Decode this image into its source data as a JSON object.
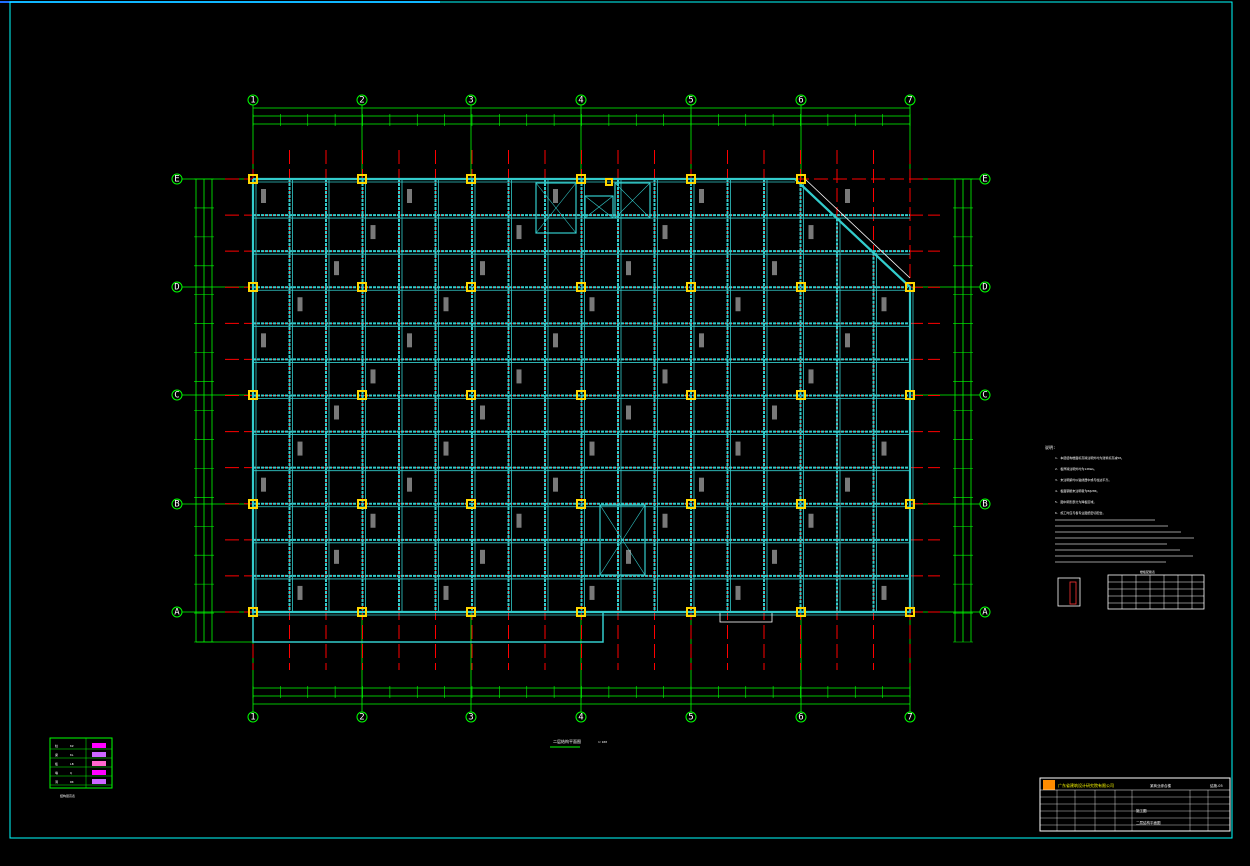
{
  "axes": {
    "columns": [
      "1",
      "2",
      "3",
      "4",
      "5",
      "6",
      "7"
    ],
    "rows": [
      "A",
      "B",
      "C",
      "D",
      "E"
    ]
  },
  "drawing": {
    "plan_title": "二层结构平面图",
    "plan_scale": "1:100"
  },
  "notes": {
    "heading": "说明:",
    "lines": [
      "1. 本层结构楼面标高除注明外均为建筑标高减50。",
      "2. 板厚除注明外均为120mm。",
      "3. 未注明梁均以轴线居中或与柱边平齐。",
      "4. 板面钢筋未注明者为8@200。",
      "5. 图中阴影部分为降板区域。",
      "6. 施工时应与各专业图纸密切配合。"
    ],
    "table_title": "楼板配筋表"
  },
  "legend": {
    "title": "图例",
    "rows": [
      {
        "label": "柱",
        "value": "KZ"
      },
      {
        "label": "梁",
        "value": "KL"
      },
      {
        "label": "板",
        "value": "LB"
      },
      {
        "label": "墙",
        "value": "Q"
      },
      {
        "label": "洞",
        "value": "DK"
      }
    ],
    "footer": "结构层高表"
  },
  "titleblock": {
    "company": "广东省建筑设计研究院有限公司",
    "project": "某商业综合楼",
    "drawing_name": "二层结构平面图",
    "stage": "施工图",
    "drawing_no": "结施-05"
  },
  "colors": {
    "grid_axis": "#00ff00",
    "beam": "#33cccc",
    "column": "#ffd700",
    "centerline": "#ff0000",
    "frame": "#00ffff",
    "text": "#ffffff"
  }
}
